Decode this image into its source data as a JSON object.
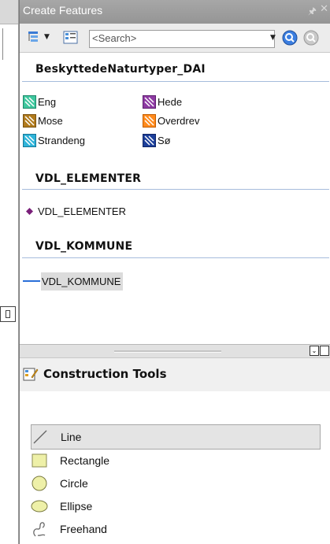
{
  "window": {
    "title": "Create Features"
  },
  "toolbar": {
    "search_placeholder": "<Search>"
  },
  "groups": [
    {
      "name": "BeskyttedeNaturtyper_DAI",
      "items": [
        {
          "label": "Eng",
          "color": "#3fc79e"
        },
        {
          "label": "Hede",
          "color": "#8e3aa3"
        },
        {
          "label": "Mose",
          "color": "#b07a1c"
        },
        {
          "label": "Overdrev",
          "color": "#ff8a1c"
        },
        {
          "label": "Strandeng",
          "color": "#2fb4d9"
        },
        {
          "label": "Sø",
          "color": "#1c3f9a"
        }
      ]
    },
    {
      "name": "VDL_ELEMENTER",
      "items": [
        {
          "label": "VDL_ELEMENTER",
          "color": "#7a1f7a"
        }
      ]
    },
    {
      "name": "VDL_KOMMUNE",
      "items": [
        {
          "label": "VDL_KOMMUNE",
          "color": "#2a6fd8"
        }
      ]
    }
  ],
  "construction_tools": {
    "title": "Construction Tools",
    "items": [
      {
        "label": "Line",
        "icon": "line-icon"
      },
      {
        "label": "Rectangle",
        "icon": "rectangle-icon"
      },
      {
        "label": "Circle",
        "icon": "circle-icon"
      },
      {
        "label": "Ellipse",
        "icon": "ellipse-icon"
      },
      {
        "label": "Freehand",
        "icon": "freehand-icon"
      }
    ]
  }
}
